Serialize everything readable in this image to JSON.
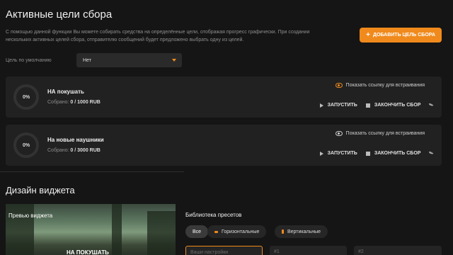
{
  "header": {
    "title": "Активные цели сбора",
    "description": "С помощью данной функции Вы можете собирать средства на определённые цели, отображая прогресс графически. При создании нескольких активных целей сбора, отправителю сообщений будет предложено выбрать одну из целей.",
    "add_button_label": "ДОБАВИТЬ ЦЕЛЬ СБОРА",
    "add_button_icon": "plus-icon"
  },
  "default_goal": {
    "label": "Цель по умолчанию",
    "selected": "Нет"
  },
  "goals": [
    {
      "progress": "0%",
      "progress_fraction": 0,
      "name": "НА покушать",
      "collected_label": "Собрано:",
      "collected_value": "0 / 1000 RUB",
      "embed_label": "Показать ссылку для встраивания",
      "start_label": "ЗАПУСТИТЬ",
      "stop_label": "ЗАКОНЧИТЬ СБОР"
    },
    {
      "progress": "0%",
      "progress_fraction": 0,
      "name": "На новые наушники",
      "collected_label": "Собрано:",
      "collected_value": "0 / 3000 RUB",
      "embed_label": "Показать ссылку для встраивания",
      "start_label": "ЗАПУСТИТЬ",
      "stop_label": "ЗАКОНЧИТЬ СБОР"
    }
  ],
  "widget_design": {
    "title": "Дизайн виджета",
    "preview_label": "Превью виджета",
    "preview_banner": "НА ПОКУШАТЬ",
    "presets_title": "Библиотека пресетов",
    "tabs": [
      {
        "label": "Все"
      },
      {
        "label": "Горизонтальные"
      },
      {
        "label": "Вертикальные"
      }
    ],
    "preset_fields": [
      {
        "placeholder": "Ваши настройки"
      },
      {
        "placeholder": "#1"
      },
      {
        "placeholder": "#2"
      }
    ]
  },
  "colors": {
    "accent": "#f08a1c",
    "background": "#151515",
    "card": "#212121"
  }
}
